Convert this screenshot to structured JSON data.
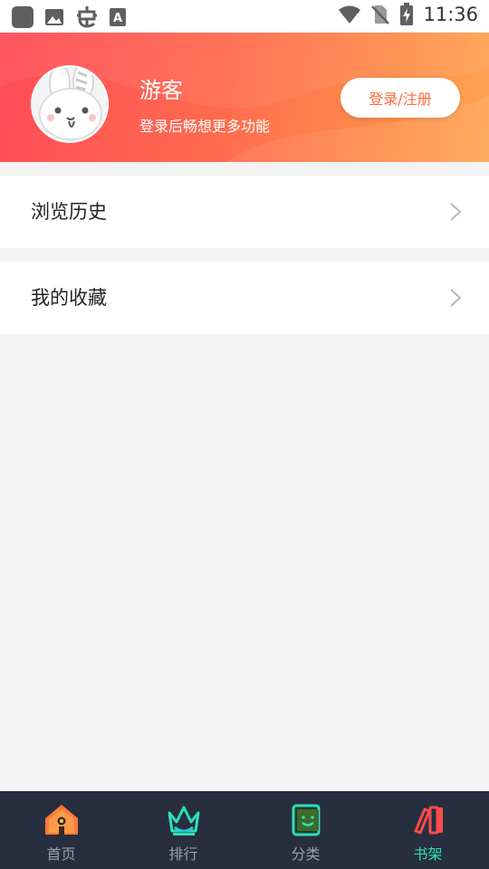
{
  "status_bar": {
    "time": "11:36",
    "left_icons": [
      "app-square-icon",
      "image-icon",
      "bug-icon",
      "font-a-icon"
    ],
    "right_icons": [
      "wifi-icon",
      "no-sim-icon",
      "battery-charging-icon"
    ]
  },
  "header": {
    "username": "游客",
    "subtitle": "登录后畅想更多功能",
    "login_button": "登录/注册",
    "gradient_colors": [
      "#ff4b58",
      "#ff8f4c",
      "#ffa552"
    ]
  },
  "menu": {
    "items": [
      {
        "label": "浏览历史",
        "icon": "chevron-right-icon"
      },
      {
        "label": "我的收藏",
        "icon": "chevron-right-icon"
      }
    ]
  },
  "bottom_nav": {
    "active_index": 3,
    "active_color": "#2ee0b8",
    "items": [
      {
        "label": "首页",
        "icon": "home-icon"
      },
      {
        "label": "排行",
        "icon": "crown-icon"
      },
      {
        "label": "分类",
        "icon": "book-smile-icon"
      },
      {
        "label": "书架",
        "icon": "bookshelf-icon"
      }
    ]
  }
}
